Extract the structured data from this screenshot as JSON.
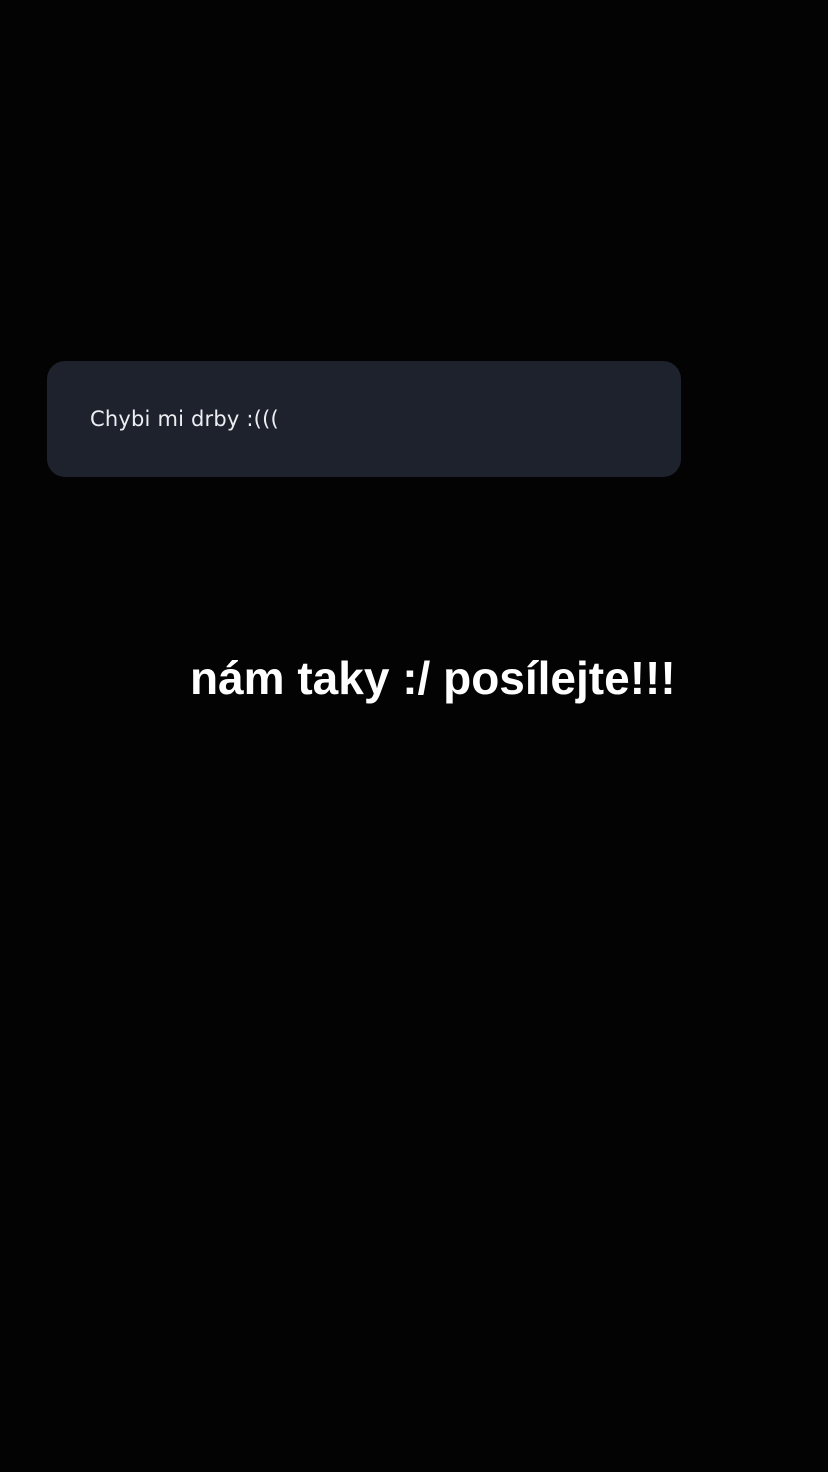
{
  "question_box": {
    "text": "Chybi mi drby :((("
  },
  "caption": {
    "text": "nám taky :/ posílejte!!!"
  },
  "colors": {
    "background": "#030303",
    "card": "#1e222d",
    "text": "#ffffff"
  }
}
